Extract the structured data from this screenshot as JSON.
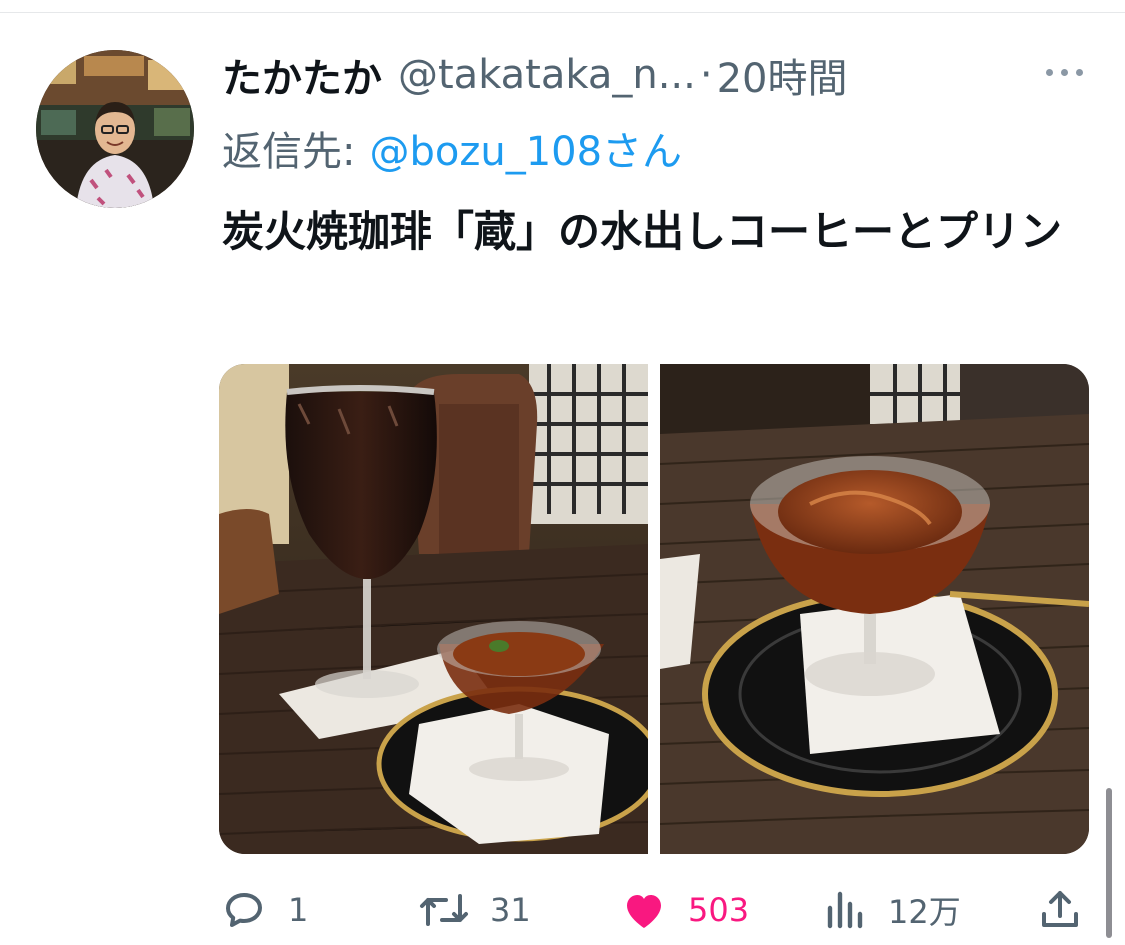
{
  "tweet": {
    "display_name": "たかたか",
    "handle": "@takataka_n...",
    "separator": "·",
    "time": "20時間",
    "reply_prefix": "返信先:",
    "reply_target": "@bozu_108さん",
    "text": "炭火焼珈琲「蔵」の水出しコーヒーとプリン"
  },
  "actions": {
    "reply_count": "1",
    "retweet_count": "31",
    "like_count": "503",
    "views_count": "12万"
  },
  "colors": {
    "accent": "#1d9bf0",
    "like": "#f91880",
    "muted": "#536471"
  },
  "icons": [
    "more-icon",
    "reply-icon",
    "retweet-icon",
    "heart-icon",
    "views-icon",
    "share-icon"
  ]
}
